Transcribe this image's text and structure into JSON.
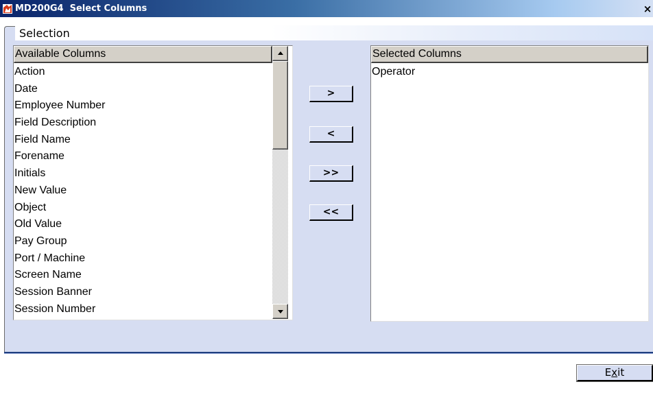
{
  "window": {
    "title": "MD200G4  Select Columns",
    "close_glyph": "×",
    "titlebar_colors": [
      "#0a246a",
      "#a6caf0"
    ]
  },
  "group": {
    "label": "Selection"
  },
  "available": {
    "header": "Available Columns",
    "items": [
      "Action",
      "Date",
      "Employee Number",
      "Field Description",
      "Field Name",
      "Forename",
      "Initials",
      "New Value",
      "Object",
      "Old Value",
      "Pay Group",
      "Port / Machine",
      "Screen Name",
      "Session Banner",
      "Session Number"
    ]
  },
  "selected": {
    "header": "Selected Columns",
    "items": [
      "Operator"
    ]
  },
  "buttons": {
    "add": ">",
    "remove": "<",
    "add_all": ">>",
    "remove_all": "<<",
    "exit_prefix": "E",
    "exit_mnemonic": "x",
    "exit_suffix": "it"
  },
  "icons": {
    "app": "app-logo-icon",
    "scroll_up": "arrow-up-icon",
    "scroll_down": "arrow-down-icon"
  }
}
